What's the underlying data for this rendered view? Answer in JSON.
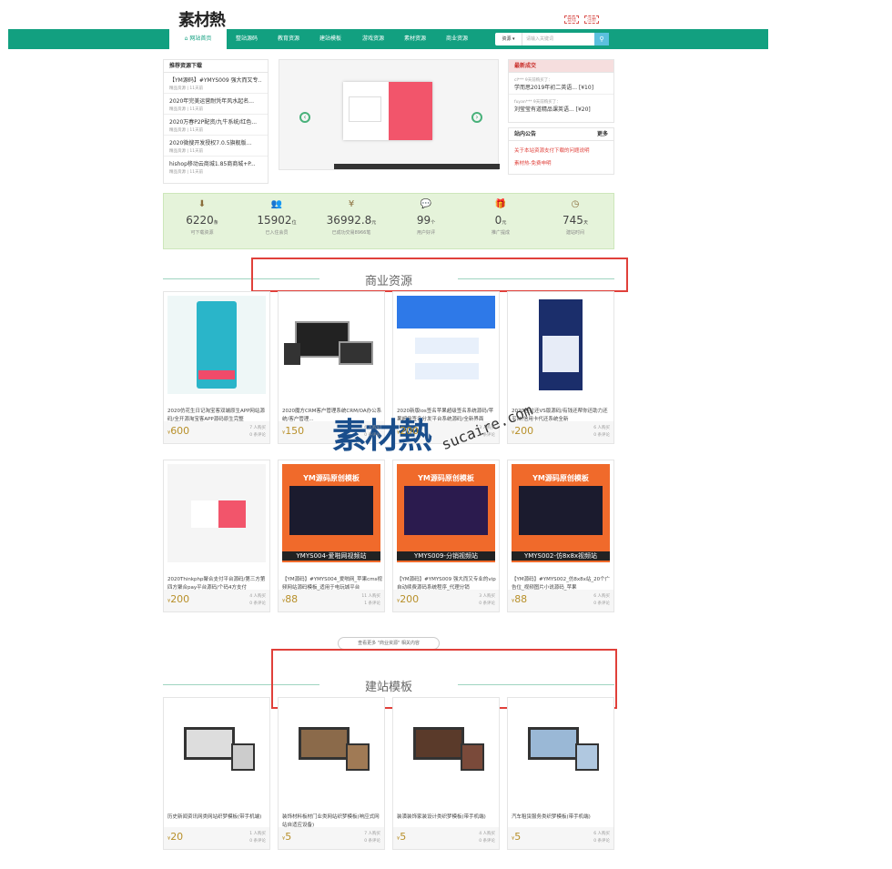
{
  "brand": {
    "logo": "素材熱"
  },
  "toplinks": {
    "login": "登陆",
    "register": "注册"
  },
  "nav": {
    "items": [
      "网站首页",
      "整站源码",
      "教育资源",
      "建站模板",
      "游戏资源",
      "素材资源",
      "商业资源"
    ],
    "search_select": "资源",
    "search_placeholder": "请输入关键词"
  },
  "recommend": {
    "title": "推荐资源下载",
    "items": [
      {
        "title": "【YM源码】#YMYS009 强大而又专...",
        "meta": "精品资源 | 11天前"
      },
      {
        "title": "2020年完美运营耐凭年风水起名...",
        "meta": "精品资源 | 11天前"
      },
      {
        "title": "2020万春P2P配资/九牛系统/红色...",
        "meta": "精品资源 | 11天前"
      },
      {
        "title": "2020微搜开发授权7.0.5旗舰版...",
        "meta": "精品资源 | 11天前"
      },
      {
        "title": "hishop移动云商城1.85商商城+P...",
        "meta": "精品资源 | 11天前"
      }
    ]
  },
  "deals": {
    "title": "最新成交",
    "items": [
      {
        "user": "cl*** 9天前购买了：",
        "item": "学而思2019年初二英语... [¥10]"
      },
      {
        "user": "fuyan*** 9天前购买了：",
        "item": "刘莹莹有道精品课英语... [¥20]"
      }
    ]
  },
  "notice": {
    "title": "站内公告",
    "more": "更多",
    "items": [
      "关于本站资源支付下载的问题说明",
      "素材热-免费申明"
    ]
  },
  "stats": [
    {
      "value": "6220",
      "unit": "条",
      "label": "可下载资源"
    },
    {
      "value": "15902",
      "unit": "位",
      "label": "已入住会员"
    },
    {
      "value": "36992.8",
      "unit": "元",
      "label": "已成功交易8966笔"
    },
    {
      "value": "99",
      "unit": "个",
      "label": "用户好评"
    },
    {
      "value": "0",
      "unit": "元",
      "label": "推广提成"
    },
    {
      "value": "745",
      "unit": "天",
      "label": "建站时间"
    }
  ],
  "section1": {
    "title": "商业资源",
    "more": "查看更多 \"商业资源\" 相关内容"
  },
  "cards1": [
    {
      "title": "2020仿花生日记淘宝客双端原生APP网站源码/全开源淘宝客APP源码原生完整",
      "price": "600",
      "buyers": "7 人购买",
      "comments": "0 条评论"
    },
    {
      "title": "2020魔方CRM客户管理系统CRM/OA办公系统/客户管理...",
      "price": "150",
      "buyers": "6 人购买",
      "comments": "0 条评论"
    },
    {
      "title": "2020新版ios签名苹果超级签名系统源码/苹果超级签名分发平台系统源码/全新界面",
      "price": "200",
      "buyers": "3 人购买",
      "comments": "0 条评论"
    },
    {
      "title": "2020挂拉还VS版源码/有钱还帮你还助力还平台/信用卡代还系统全新",
      "price": "200",
      "buyers": "6 人购买",
      "comments": "0 条评论"
    },
    {
      "title": "2020Thinkphp聚合支付平台源码/第三方第四方聚合pay平台源码/个码4方支付",
      "price": "200",
      "buyers": "4 人购买",
      "comments": "0 条评论"
    },
    {
      "title": "【YM源码】#YMYS004_爱啪网_苹果cms视频网站源码模板_适用于电玩城平台",
      "price": "88",
      "buyers": "11 人购买",
      "comments": "1 条评论"
    },
    {
      "title": "【YM源码】#YMYS009 强大而又专业的vip自动续费源码系统程序_代理分销",
      "price": "200",
      "buyers": "3 人购买",
      "comments": "0 条评论"
    },
    {
      "title": "【YM源码】#YMYS002_仿8x8x站_20个广告位_视频图片小说源码_苹果",
      "price": "88",
      "buyers": "6 人购买",
      "comments": "0 条评论"
    }
  ],
  "banners": [
    "YMYS004-爱啪网视频站",
    "YMYS009-分销视频站",
    "YMYS002-仿8x8x视频站"
  ],
  "banner_head": "YM源码原创模板",
  "section2": {
    "title": "建站模板"
  },
  "cards2": [
    {
      "title": "历史新闻资讯网类网站织梦模板(带手机端)",
      "price": "20",
      "buyers": "1 人购买",
      "comments": "0 条评论"
    },
    {
      "title": "装饰材料板材门业类网站织梦模板(响应式网站自适应设备)",
      "price": "5",
      "buyers": "7 人购买",
      "comments": "0 条评论"
    },
    {
      "title": "装潢装饰家装设计类织梦模板(带手机端)",
      "price": "5",
      "buyers": "4 人购买",
      "comments": "0 条评论"
    },
    {
      "title": "汽车租赁服务类织梦模板(带手机端)",
      "price": "5",
      "buyers": "6 人购买",
      "comments": "0 条评论"
    }
  ],
  "watermark": {
    "main": "素材熱",
    "sub": "sucaire.com"
  },
  "currency": "¥",
  "colors": {
    "nav": "#12a080",
    "accent": "#b8902a",
    "highlight": "#e0403a"
  }
}
